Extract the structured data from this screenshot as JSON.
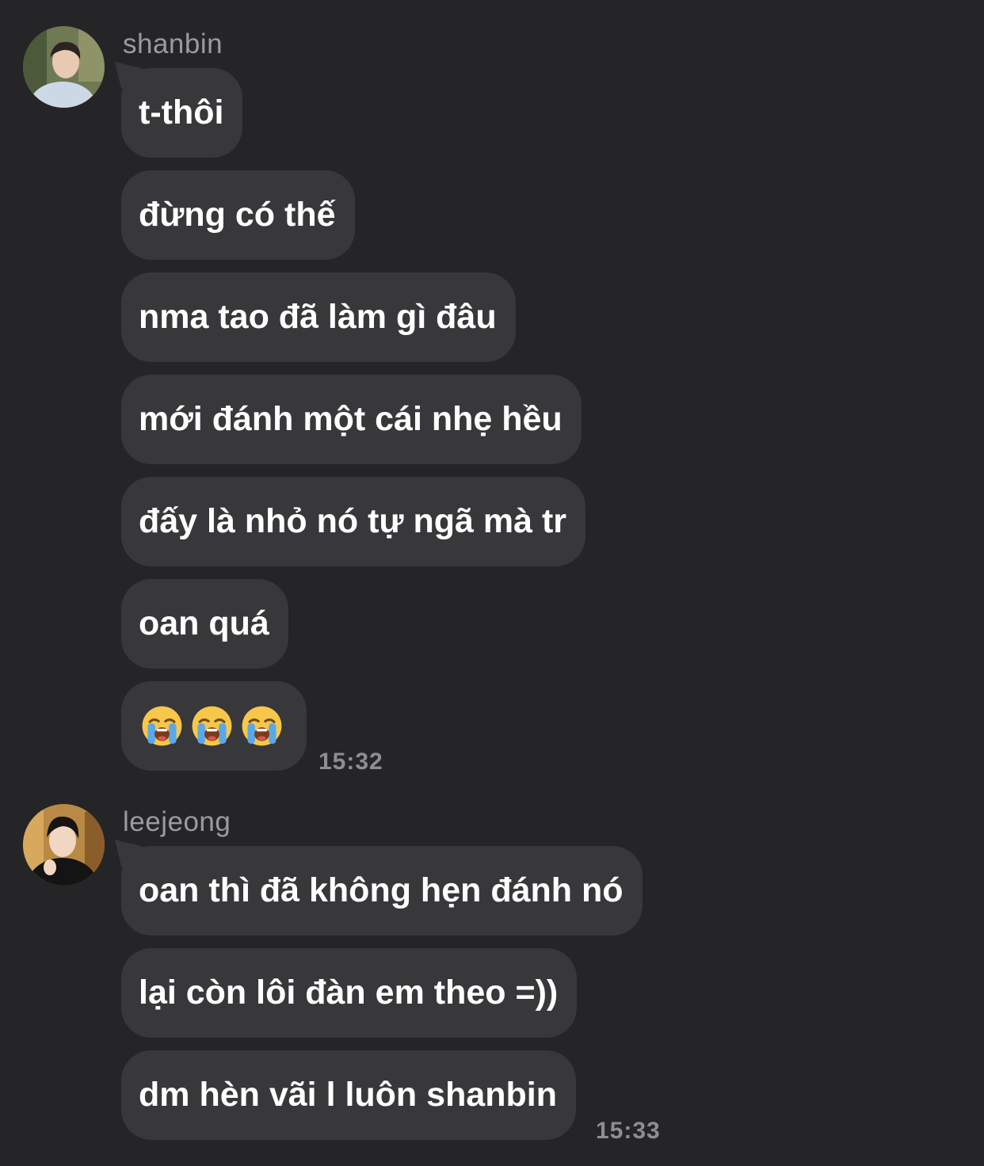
{
  "groups": [
    {
      "sender": "shanbin",
      "messages": [
        "t-thôi",
        "đừng có thế",
        "nma tao đã làm gì đâu",
        "mới đánh một cái nhẹ hều",
        "đấy là nhỏ nó tự ngã mà tr",
        "oan quá"
      ],
      "emoji_message": {
        "icon": "loudly-crying-face",
        "count": 3
      },
      "time": "15:32"
    },
    {
      "sender": "leejeong",
      "messages": [
        "oan thì đã không hẹn đánh nó",
        "lại còn lôi đàn em theo =))",
        "dm hèn vãi l luôn shanbin"
      ],
      "time": "15:33"
    }
  ],
  "colors": {
    "background": "#252527",
    "bubble": "#38383b",
    "text": "#ffffff",
    "meta": "#8e8e92"
  }
}
